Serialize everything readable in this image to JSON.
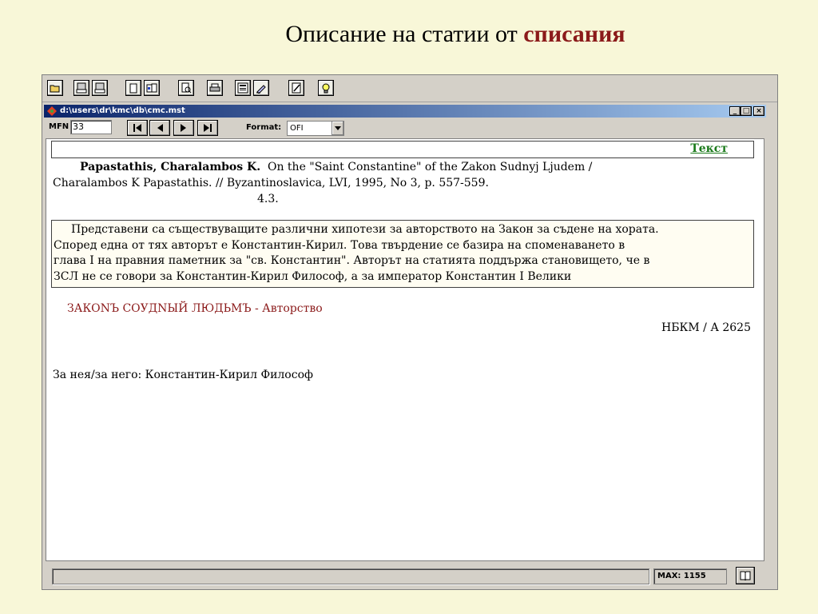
{
  "slide": {
    "title_main": "Описание на статии от",
    "title_accent": "списания"
  },
  "toolbar": {
    "icons": [
      "open-folder-icon",
      "txt-export-icon",
      "rtf-export-icon",
      "copy-icon",
      "clipboard-icon",
      "preview-icon",
      "print-icon",
      "save-icon",
      "edit-icon",
      "notepad-icon",
      "tip-icon"
    ]
  },
  "window": {
    "title": "d:\\users\\dr\\kmc\\db\\cmc.mst",
    "minimize": "_",
    "maximize": "□",
    "close": "×"
  },
  "nav": {
    "mfn_label": "MFN",
    "mfn_value": "33",
    "format_label": "Format:",
    "format_value": "OFI"
  },
  "record": {
    "label": "Текст",
    "author": "Papastathis, Charalambos K.",
    "title_part": "On the \"Saint Constantine\" of the Zakon Sudnyj Ljudem /",
    "line2": "Charalambos K Papastathis. // Byzantinoslavica, LVI, 1995, No 3,  p. 557-559.",
    "code": "4.3.",
    "abstract_lines": [
      "Представени са съществуващите различни хипотези за авторството на Закон за съдене на  хората.",
      "Според една от тях авторът е Константин-Кирил. Това твърдение се базира на споменаването  в",
      "глава I на правния паметник за \"св. Константин\". Авторът на статията поддържа становището, че  в",
      "ЗСЛ не се говори за Константин-Кирил Философ, а за император Константин I Велики"
    ],
    "subject": "ЗАКОNЪ СОУДNЫЙ ЛЮДЬМЪ - Авторство",
    "shelf": "НБКМ / А 2625",
    "about": "За нея/за него: Константин-Кирил Философ"
  },
  "status": {
    "message": "",
    "max": "MAX: 1155"
  },
  "colors": {
    "slide_bg": "#f8f7d8",
    "accent": "#8b1a1a",
    "label_green": "#1a7a1a",
    "titlebar": "#0a246a"
  }
}
